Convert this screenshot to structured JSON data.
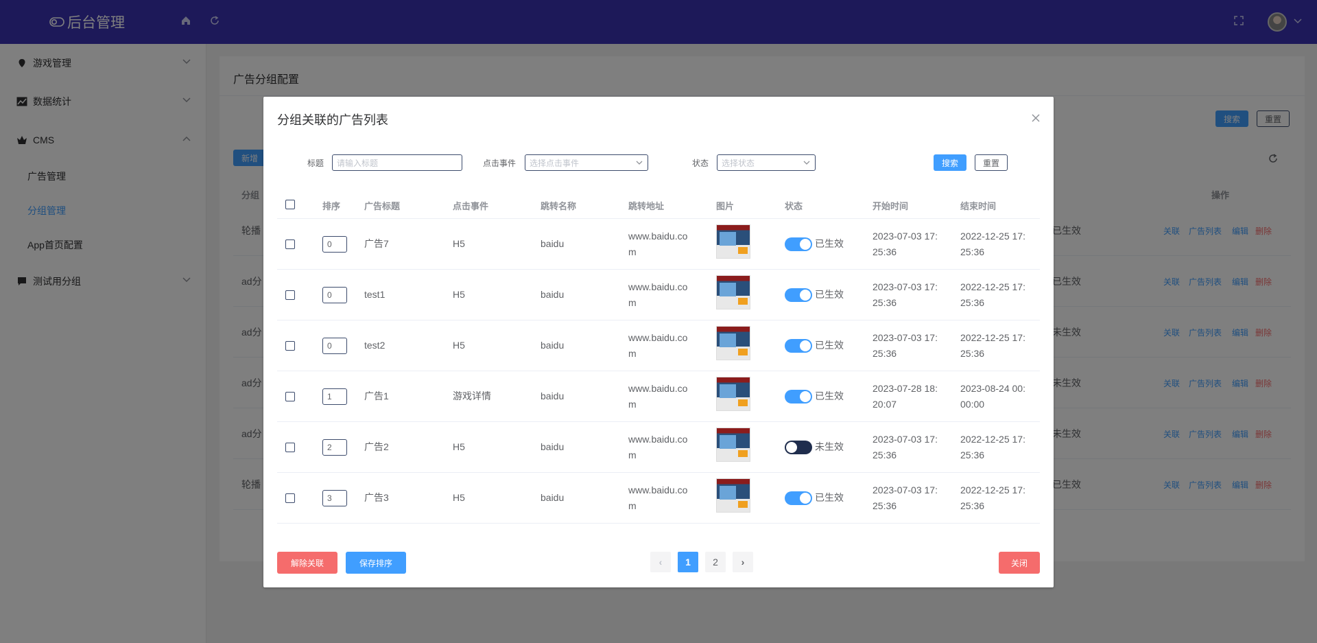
{
  "header": {
    "brand": "后台管理",
    "colors": {
      "header_bg": "#3b33b3",
      "accent": "#409eff",
      "danger": "#f56c6c"
    }
  },
  "sidebar": {
    "items": [
      {
        "label": "游戏管理",
        "icon": "location-pin-icon"
      },
      {
        "label": "数据统计",
        "icon": "line-chart-icon"
      },
      {
        "label": "CMS",
        "icon": "crown-icon",
        "expanded": true
      },
      {
        "label": "测试用分组",
        "icon": "chat-icon"
      }
    ],
    "cms_children": [
      {
        "label": "广告管理",
        "active": false
      },
      {
        "label": "分组管理",
        "active": true
      },
      {
        "label": "App首页配置",
        "active": false
      }
    ]
  },
  "main": {
    "title": "广告分组配置",
    "search_label": "搜索",
    "reset_label": "重置",
    "add_label": "新增",
    "col_group": "分组",
    "col_actions": "操作",
    "rows": [
      {
        "name": "轮播",
        "status": "已生效"
      },
      {
        "name": "ad分",
        "status": "已生效"
      },
      {
        "name": "ad分",
        "status": "未生效"
      },
      {
        "name": "ad分",
        "status": "未生效"
      },
      {
        "name": "ad分",
        "status": "未生效"
      },
      {
        "name": "轮播",
        "status": "已生效"
      }
    ],
    "row_actions": [
      "关联",
      "广告列表",
      "编辑",
      "删除"
    ]
  },
  "dialog": {
    "title": "分组关联的广告列表",
    "filters": {
      "title_label": "标题",
      "title_placeholder": "请输入标题",
      "event_label": "点击事件",
      "event_placeholder": "选择点击事件",
      "status_label": "状态",
      "status_placeholder": "选择状态"
    },
    "search_label": "搜索",
    "reset_label": "重置",
    "columns": [
      "排序",
      "广告标题",
      "点击事件",
      "跳转名称",
      "跳转地址",
      "图片",
      "状态",
      "开始时间",
      "结束时间"
    ],
    "rows": [
      {
        "sort": "0",
        "title": "广告7",
        "event": "H5",
        "jump_name": "baidu",
        "url1": "www.baidu.co",
        "url2": "m",
        "on": true,
        "status": "已生效",
        "start1": "2023-07-03 17:",
        "start2": "25:36",
        "end1": "2022-12-25 17:",
        "end2": "25:36"
      },
      {
        "sort": "0",
        "title": "test1",
        "event": "H5",
        "jump_name": "baidu",
        "url1": "www.baidu.co",
        "url2": "m",
        "on": true,
        "status": "已生效",
        "start1": "2023-07-03 17:",
        "start2": "25:36",
        "end1": "2022-12-25 17:",
        "end2": "25:36"
      },
      {
        "sort": "0",
        "title": "test2",
        "event": "H5",
        "jump_name": "baidu",
        "url1": "www.baidu.co",
        "url2": "m",
        "on": true,
        "status": "已生效",
        "start1": "2023-07-03 17:",
        "start2": "25:36",
        "end1": "2022-12-25 17:",
        "end2": "25:36"
      },
      {
        "sort": "1",
        "title": "广告1",
        "event": "游戏详情",
        "jump_name": "baidu",
        "url1": "www.baidu.co",
        "url2": "m",
        "on": true,
        "status": "已生效",
        "start1": "2023-07-28 18:",
        "start2": "20:07",
        "end1": "2023-08-24 00:",
        "end2": "00:00"
      },
      {
        "sort": "2",
        "title": "广告2",
        "event": "H5",
        "jump_name": "baidu",
        "url1": "www.baidu.co",
        "url2": "m",
        "on": false,
        "status": "未生效",
        "start1": "2023-07-03 17:",
        "start2": "25:36",
        "end1": "2022-12-25 17:",
        "end2": "25:36"
      },
      {
        "sort": "3",
        "title": "广告3",
        "event": "H5",
        "jump_name": "baidu",
        "url1": "www.baidu.co",
        "url2": "m",
        "on": true,
        "status": "已生效",
        "start1": "2023-07-03 17:",
        "start2": "25:36",
        "end1": "2022-12-25 17:",
        "end2": "25:36"
      }
    ],
    "unlink_label": "解除关联",
    "save_sort_label": "保存排序",
    "close_label": "关闭",
    "pagination": {
      "prev": "‹",
      "next": "›",
      "pages": [
        "1",
        "2"
      ],
      "current": "1"
    }
  }
}
